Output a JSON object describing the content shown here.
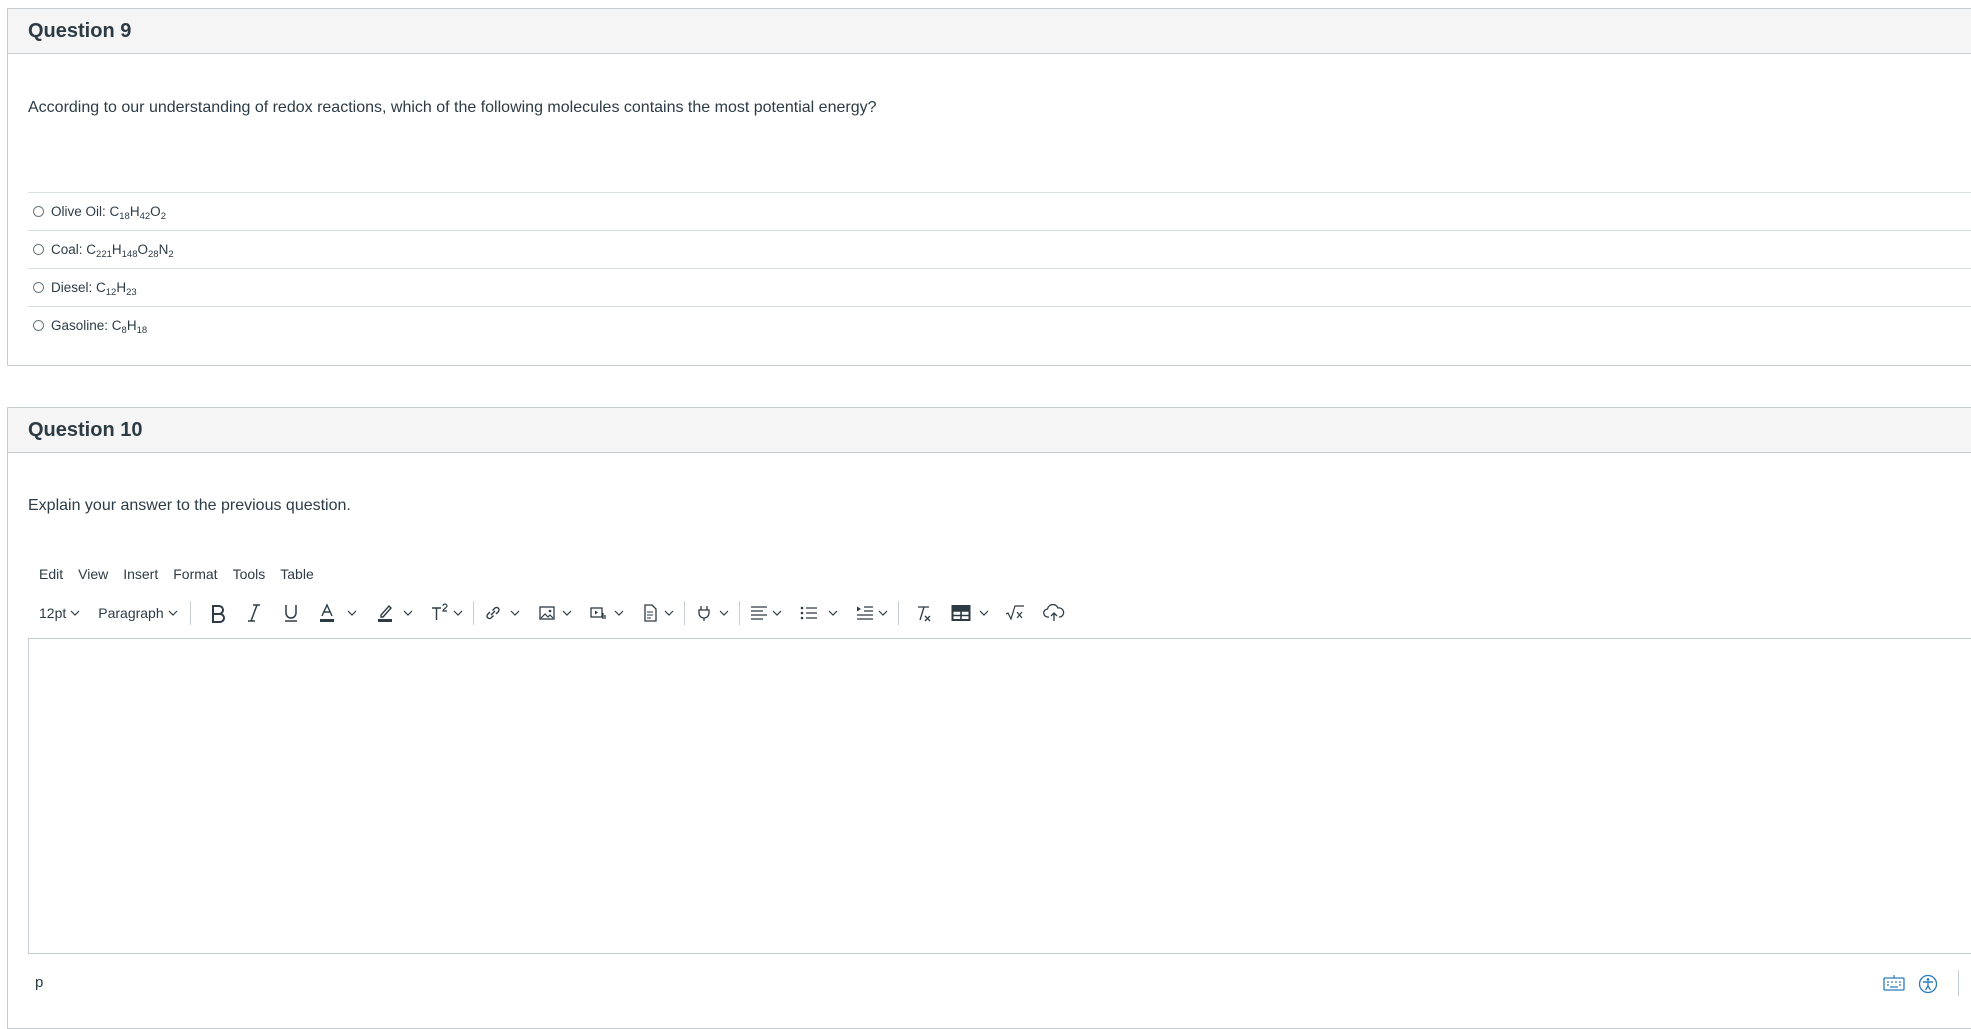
{
  "question9": {
    "title": "Question 9",
    "text": "According to our understanding of redox reactions, which of the following molecules contains the most potential energy?",
    "answers": [
      {
        "label": "Olive Oil: ",
        "formula": [
          [
            "C",
            "18"
          ],
          [
            "H",
            "42"
          ],
          [
            "O",
            "2"
          ]
        ]
      },
      {
        "label": "Coal: ",
        "formula": [
          [
            "C",
            "221"
          ],
          [
            "H",
            "148"
          ],
          [
            "O",
            "28"
          ],
          [
            "N",
            "2"
          ]
        ]
      },
      {
        "label": "Diesel: ",
        "formula": [
          [
            "C",
            "12"
          ],
          [
            "H",
            "23"
          ]
        ]
      },
      {
        "label": "Gasoline: ",
        "formula": [
          [
            "C",
            "8"
          ],
          [
            "H",
            "18"
          ]
        ]
      }
    ]
  },
  "question10": {
    "title": "Question 10",
    "text": "Explain your answer to the previous question."
  },
  "editor": {
    "menu": [
      "Edit",
      "View",
      "Insert",
      "Format",
      "Tools",
      "Table"
    ],
    "font_size": "12pt",
    "block_format": "Paragraph",
    "path": "p"
  },
  "colors": {
    "header_bg": "#f5f5f5",
    "border": "#c7cdd1",
    "text": "#2d3b45",
    "accent": "#2b7abc"
  }
}
